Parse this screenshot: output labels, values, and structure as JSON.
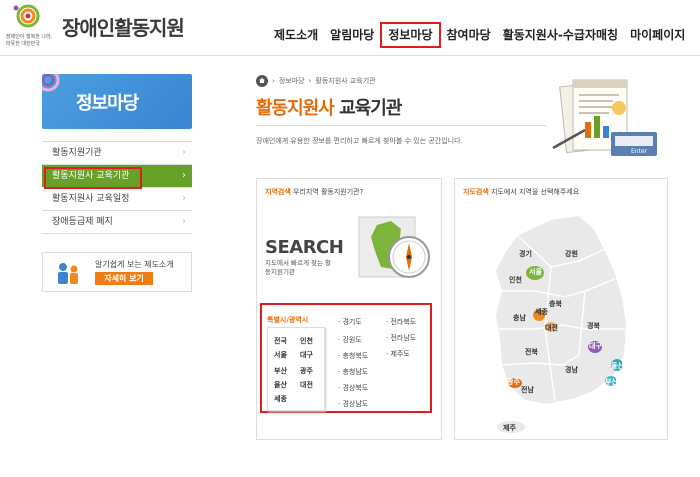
{
  "header": {
    "logo_title": "장애인활동지원",
    "logo_slogan_1": "장애인이 행복한 나라,",
    "logo_slogan_2": "따뜻한 대한민국",
    "nav": [
      "제도소개",
      "알림마당",
      "정보마당",
      "참여마당",
      "활동지원사-수급자매칭",
      "마이페이지"
    ],
    "active_nav": "정보마당"
  },
  "sidebar": {
    "banner_title": "정보마당",
    "items": [
      {
        "label": "활동지원기관"
      },
      {
        "label": "활동지원사 교육기관",
        "active": true
      },
      {
        "label": "활동지원사 교육일정"
      },
      {
        "label": "장애등급제 폐지"
      }
    ],
    "promo_text": "알기쉽게 보는 제도소개",
    "promo_button": "자세히 보기"
  },
  "breadcrumb": [
    "정보마당",
    "활동지원사 교육기관"
  ],
  "page": {
    "title_main": "활동지원사",
    "title_sub": "교육기관",
    "description": "장애인에게 유용한 정보를 편리하고 빠르게 찾아볼 수 있는 공간입니다."
  },
  "region_search": {
    "head_bold": "지역검색",
    "head_text": "우리지역 활동지원기관?",
    "search_word": "SEARCH",
    "search_desc": "지도에서 빠르게 찾는 활동지원기관",
    "subtitle": "특별시/광역시",
    "cities": [
      "전국",
      "인천",
      "서울",
      "대구",
      "부산",
      "광주",
      "울산",
      "대전",
      "세종"
    ],
    "provinces": [
      "경기도",
      "전라북도",
      "강원도",
      "전라남도",
      "충청북도",
      "제주도",
      "충청남도",
      "경상북도",
      "경상남도"
    ]
  },
  "map_search": {
    "head_bold": "지도검색",
    "head_text": "지도에서 지역을 선택해주세요",
    "regions": [
      "경기",
      "강원",
      "서울",
      "인천",
      "충북",
      "충남",
      "세종",
      "대전",
      "경북",
      "전북",
      "대구",
      "경남",
      "울산",
      "광주",
      "부산",
      "전남",
      "제주"
    ]
  },
  "colors": {
    "accent_orange": "#e46c0a",
    "nav_green": "#68a12a",
    "banner_blue": "#3a84d2",
    "highlight_red": "#e21d1d"
  }
}
